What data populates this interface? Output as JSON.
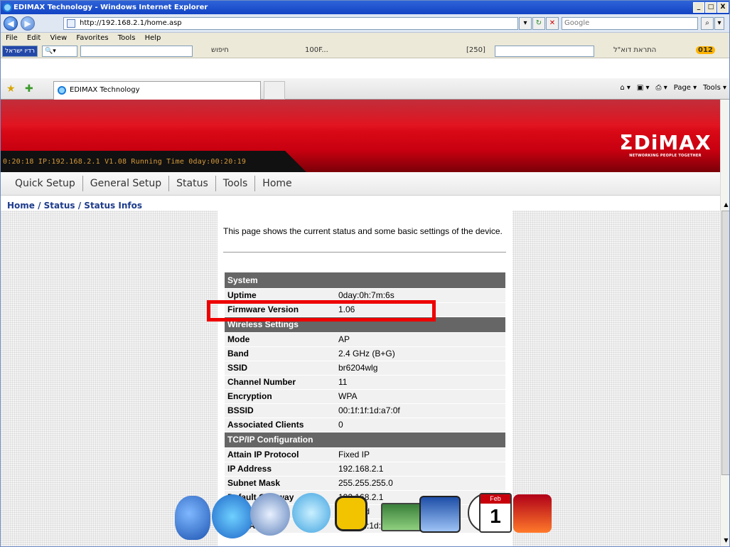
{
  "window": {
    "title": "EDIMAX Technology - Windows Internet Explorer",
    "controls": [
      "_",
      "□",
      "X"
    ]
  },
  "addressbar": {
    "back": "◀",
    "forward": "▶",
    "url": "http://192.168.2.1/home.asp",
    "search_placeholder": "Google",
    "refresh": "↻",
    "stop": "✕",
    "search_btn": "⌕"
  },
  "menubar": {
    "items": [
      "File",
      "Edit",
      "View",
      "Favorites",
      "Tools",
      "Help"
    ]
  },
  "toolbar_heb": {
    "left_box": "רדיו ישראל",
    "search_label": "חיפוש",
    "zoom_label": "100F...",
    "count_label": "[250]",
    "mail_label": "התראת דוא\"ל",
    "badge": "012"
  },
  "tabs": {
    "active_label": "EDIMAX Technology"
  },
  "commandbar": {
    "items": [
      "⌂ ▾",
      "▣ ▾",
      "⎙ ▾",
      "Page ▾",
      "Tools ▾"
    ]
  },
  "banner": {
    "status_text": "0:20:18  IP:192.168.2.1  V1.08  Running Time 0day:00:20:19",
    "logo_word": "ΣDiMAX",
    "logo_tagline": "NETWORKING PEOPLE TOGETHER"
  },
  "nav": {
    "items": [
      "Quick Setup",
      "General Setup",
      "Status",
      "Tools",
      "Home"
    ]
  },
  "breadcrumb": "Home / Status / Status Infos",
  "intro": "This page shows the current status and some basic settings of the device.",
  "status_table": [
    {
      "type": "header",
      "label": "System"
    },
    {
      "type": "row",
      "label": "Uptime",
      "value": "0day:0h:7m:6s"
    },
    {
      "type": "row",
      "label": "Firmware Version",
      "value": "1.06"
    },
    {
      "type": "header",
      "label": "Wireless Settings"
    },
    {
      "type": "row",
      "label": "Mode",
      "value": "AP"
    },
    {
      "type": "row",
      "label": "Band",
      "value": "2.4 GHz (B+G)"
    },
    {
      "type": "row",
      "label": "SSID",
      "value": "br6204wlg"
    },
    {
      "type": "row",
      "label": "Channel Number",
      "value": "11"
    },
    {
      "type": "row",
      "label": "Encryption",
      "value": "WPA"
    },
    {
      "type": "row",
      "label": "BSSID",
      "value": "00:1f:1f:1d:a7:0f"
    },
    {
      "type": "row",
      "label": "Associated Clients",
      "value": "0"
    },
    {
      "type": "header",
      "label": "TCP/IP Configuration"
    },
    {
      "type": "row",
      "label": "Attain IP Protocol",
      "value": "Fixed IP"
    },
    {
      "type": "row",
      "label": "IP Address",
      "value": "192.168.2.1"
    },
    {
      "type": "row",
      "label": "Subnet Mask",
      "value": "255.255.255.0"
    },
    {
      "type": "row",
      "label": "Default Gateway",
      "value": "192.168.2.1"
    },
    {
      "type": "row",
      "label": "DHCP Server",
      "value": "Enabled"
    },
    {
      "type": "row",
      "label": "MAC Address",
      "value": "00:1f:1f:1d:a7:0f"
    }
  ],
  "dock": {
    "icons": [
      "apple-icon",
      "internet-explorer-icon",
      "mail-icon",
      "skype-icon",
      "notes-icon",
      "monitor-icon",
      "printer-icon",
      "clock-icon",
      "calendar-icon",
      "app-icon"
    ],
    "calendar_month": "Feb",
    "calendar_day": "1"
  },
  "colors": {
    "banner_red": "#d6000f",
    "status_orange": "#d79a3a",
    "highlight": "#ee0000",
    "header_gray": "#666666",
    "crumb_blue": "#1d3b8c"
  }
}
